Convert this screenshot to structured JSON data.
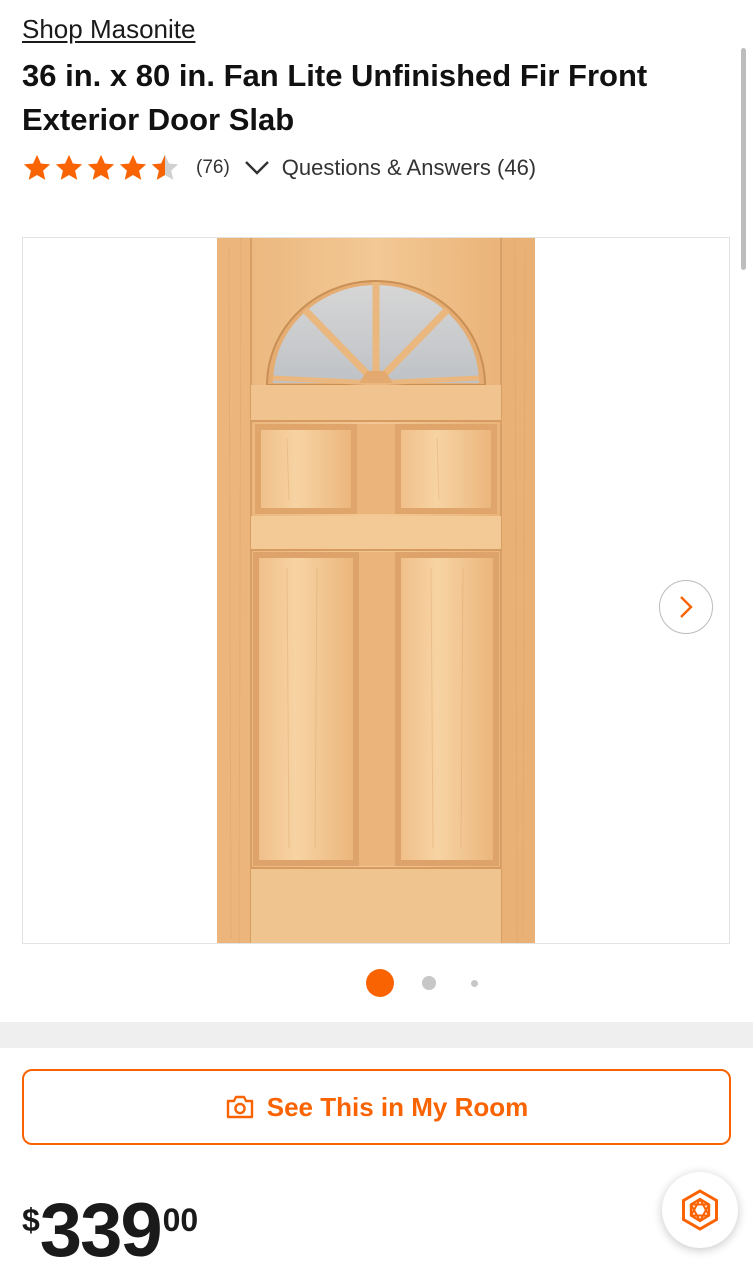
{
  "product": {
    "brand_link": "Shop Masonite",
    "title": "36 in. x 80 in. Fan Lite Unfinished Fir Front Exterior Door Slab",
    "rating": 4.5,
    "review_count": "(76)",
    "qa_label": "Questions & Answers (46)"
  },
  "gallery": {
    "image_alt": "Fan lite unfinished fir door slab",
    "active_index": 1,
    "total_dots": 3
  },
  "actions": {
    "see_in_room": "See This in My Room"
  },
  "price": {
    "currency": "$",
    "whole": "339",
    "cents": "00"
  },
  "colors": {
    "accent": "#f96302",
    "star": "#f96302"
  },
  "icons": {
    "star": "star-icon",
    "expand": "chevron-down-icon",
    "next": "chevron-right-icon",
    "camera": "camera-icon",
    "assistant": "hexagon-assistant-icon"
  }
}
